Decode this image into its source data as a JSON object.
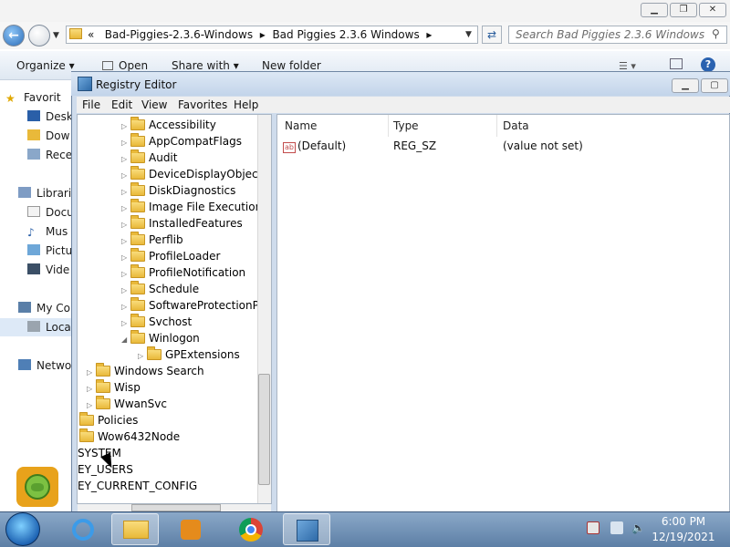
{
  "explorer": {
    "address_prefix": "«",
    "breadcrumbs": [
      "Bad-Piggies-2.3.6-Windows",
      "Bad Piggies 2.3.6 Windows"
    ],
    "search_placeholder": "Search Bad Piggies 2.3.6 Windows",
    "toolbar": [
      "Organize ▾",
      "Open",
      "Share with ▾",
      "New folder"
    ],
    "nav_items": [
      {
        "label": "Favorit",
        "icon": "star-icon"
      },
      {
        "label": "Desk",
        "icon": "desktop-icon"
      },
      {
        "label": "Dow",
        "icon": "downloads-icon"
      },
      {
        "label": "Rece",
        "icon": "recent-icon"
      },
      {
        "label": "Librari",
        "icon": "libraries-icon"
      },
      {
        "label": "Docu",
        "icon": "documents-icon"
      },
      {
        "label": "Mus",
        "icon": "music-icon"
      },
      {
        "label": "Pictu",
        "icon": "pictures-icon"
      },
      {
        "label": "Vide",
        "icon": "videos-icon"
      },
      {
        "label": "My Co",
        "icon": "computer-icon"
      },
      {
        "label": "Loca",
        "icon": "disk-icon"
      },
      {
        "label": "Netwo",
        "icon": "network-icon"
      }
    ]
  },
  "registry": {
    "title": "Registry Editor",
    "menu": [
      "File",
      "Edit",
      "View",
      "Favorites",
      "Help"
    ],
    "tree": [
      {
        "label": "Accessibility",
        "level": 3,
        "expander": "▷"
      },
      {
        "label": "AppCompatFlags",
        "level": 3,
        "expander": "▷"
      },
      {
        "label": "Audit",
        "level": 3,
        "expander": "▷"
      },
      {
        "label": "DeviceDisplayObjects",
        "level": 3,
        "expander": "▷"
      },
      {
        "label": "DiskDiagnostics",
        "level": 3,
        "expander": "▷"
      },
      {
        "label": "Image File Execution C",
        "level": 3,
        "expander": "▷"
      },
      {
        "label": "InstalledFeatures",
        "level": 3,
        "expander": "▷"
      },
      {
        "label": "Perflib",
        "level": 3,
        "expander": "▷"
      },
      {
        "label": "ProfileLoader",
        "level": 3,
        "expander": "▷"
      },
      {
        "label": "ProfileNotification",
        "level": 3,
        "expander": "▷"
      },
      {
        "label": "Schedule",
        "level": 3,
        "expander": "▷"
      },
      {
        "label": "SoftwareProtectionPla",
        "level": 3,
        "expander": "▷"
      },
      {
        "label": "Svchost",
        "level": 3,
        "expander": "▷"
      },
      {
        "label": "Winlogon",
        "level": 3,
        "expander": "◢"
      },
      {
        "label": "GPExtensions",
        "level": 4,
        "expander": "▷"
      },
      {
        "label": "Windows Search",
        "level": 1,
        "expander": "▷"
      },
      {
        "label": "Wisp",
        "level": 1,
        "expander": "▷"
      },
      {
        "label": "WwanSvc",
        "level": 1,
        "expander": "▷"
      },
      {
        "label": "Policies",
        "level": 0,
        "expander": ""
      },
      {
        "label": "Wow6432Node",
        "level": 0,
        "expander": ""
      },
      {
        "label": "SYSTEM",
        "level": -1,
        "expander": ""
      },
      {
        "label": "EY_USERS",
        "level": -1,
        "expander": ""
      },
      {
        "label": "EY_CURRENT_CONFIG",
        "level": -1,
        "expander": ""
      }
    ],
    "columns": [
      "Name",
      "Type",
      "Data"
    ],
    "values": [
      {
        "name": "(Default)",
        "type": "REG_SZ",
        "data": "(value not set)"
      }
    ]
  },
  "taskbar": {
    "apps": [
      "internet-explorer-icon",
      "file-explorer-icon",
      "media-player-icon",
      "chrome-icon",
      "regedit-icon"
    ],
    "active_app": "regedit-icon",
    "time": "6:00 PM",
    "date": "12/19/2021"
  },
  "colors": {
    "title_gradient": "#c3d4ea",
    "folder_yellow": "#e9b93a",
    "taskbar_blue": "#5d7fa6"
  }
}
